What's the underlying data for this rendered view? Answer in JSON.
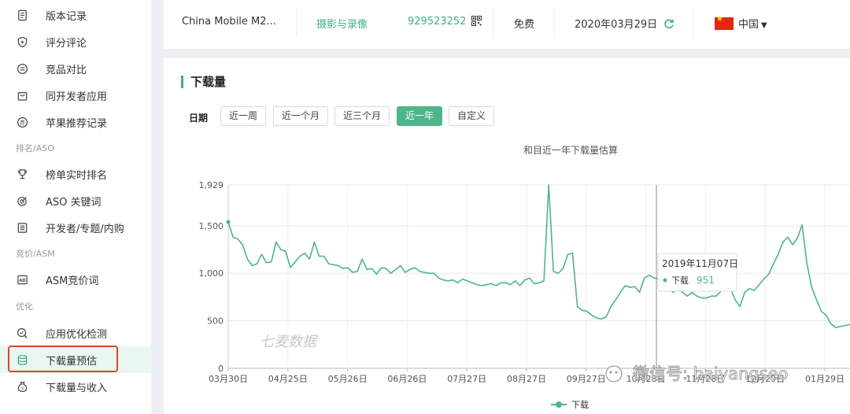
{
  "sidebar": {
    "items": [
      {
        "label": "版本记录",
        "icon": "document-icon"
      },
      {
        "label": "评分评论",
        "icon": "shield-icon"
      },
      {
        "label": "竞品对比",
        "icon": "compare-icon"
      },
      {
        "label": "同开发者应用",
        "icon": "bag-icon"
      },
      {
        "label": "苹果推荐记录",
        "icon": "badge-icon"
      }
    ],
    "cat_rank": "排名/ASO",
    "rank_items": [
      {
        "label": "榜单实时排名",
        "icon": "trophy-icon"
      },
      {
        "label": "ASO 关键词",
        "icon": "target-icon"
      },
      {
        "label": "开发者/专题/内购",
        "icon": "list-icon"
      }
    ],
    "cat_bid": "竞价/ASM",
    "bid_items": [
      {
        "label": "ASM竞价词",
        "icon": "ad-icon"
      }
    ],
    "cat_opt": "优化",
    "opt_items": [
      {
        "label": "应用优化检测",
        "icon": "search-check-icon"
      },
      {
        "label": "下载量预估",
        "icon": "database-icon"
      },
      {
        "label": "下载量与收入",
        "icon": "money-bag-icon"
      }
    ]
  },
  "info": {
    "app_name": "China Mobile M2...",
    "category": "摄影与录像",
    "app_id": "929523252",
    "price": "免费",
    "date": "2020年03月29日",
    "country": "中国"
  },
  "section": {
    "title": "下载量",
    "date_label": "日期",
    "ranges": [
      "近一周",
      "近一个月",
      "近三个月",
      "近一年",
      "自定义"
    ],
    "active_range": "近一年"
  },
  "chart_data": {
    "type": "line",
    "title": "和目近一年下载量估算",
    "xlabel": "",
    "ylabel": "",
    "ylim": [
      0,
      1929
    ],
    "yticks": [
      0,
      500,
      1000,
      1500,
      1929
    ],
    "yticklabels": [
      "0",
      "500",
      "1,000",
      "1,500",
      "1,929"
    ],
    "xticklabels": [
      "03月30日",
      "04月25日",
      "05月26日",
      "06月26日",
      "07月27日",
      "08月27日",
      "09月27日",
      "10月28日",
      "11月28日",
      "12月29日",
      "01月29日"
    ],
    "legend": "bottom-center",
    "grid": true,
    "series": [
      {
        "name": "下载",
        "color": "#4fb58a",
        "values": [
          1540,
          1380,
          1360,
          1300,
          1150,
          1080,
          1100,
          1200,
          1110,
          1120,
          1330,
          1250,
          1230,
          1060,
          1120,
          1180,
          1210,
          1150,
          1330,
          1180,
          1180,
          1100,
          1090,
          1080,
          1050,
          1060,
          1010,
          1020,
          1150,
          1040,
          1050,
          990,
          1060,
          1050,
          1000,
          1040,
          1080,
          1010,
          1040,
          1060,
          1020,
          1010,
          1000,
          1000,
          950,
          930,
          920,
          930,
          900,
          940,
          920,
          900,
          880,
          870,
          880,
          890,
          870,
          900,
          900,
          880,
          920,
          870,
          930,
          950,
          890,
          900,
          920,
          1929,
          1020,
          1000,
          1050,
          1200,
          1210,
          650,
          610,
          600,
          560,
          530,
          520,
          540,
          650,
          720,
          800,
          870,
          850,
          860,
          800,
          950,
          980,
          951,
          940,
          880,
          850,
          800,
          830,
          800,
          760,
          800,
          760,
          740,
          740,
          760,
          760,
          810,
          840,
          840,
          720,
          650,
          800,
          840,
          820,
          880,
          940,
          990,
          1100,
          1200,
          1330,
          1380,
          1300,
          1370,
          1510,
          1100,
          850,
          720,
          600,
          560,
          470,
          430,
          440,
          450,
          460
        ]
      }
    ],
    "tooltip": {
      "title": "2019年11月07日",
      "series": "下载",
      "value": "951"
    },
    "watermark": "七麦数据"
  },
  "overlay": {
    "wechat_text": "微信号: baiyangseo"
  },
  "colors": {
    "accent": "#4fb58a",
    "highlight": "#d9442f"
  }
}
